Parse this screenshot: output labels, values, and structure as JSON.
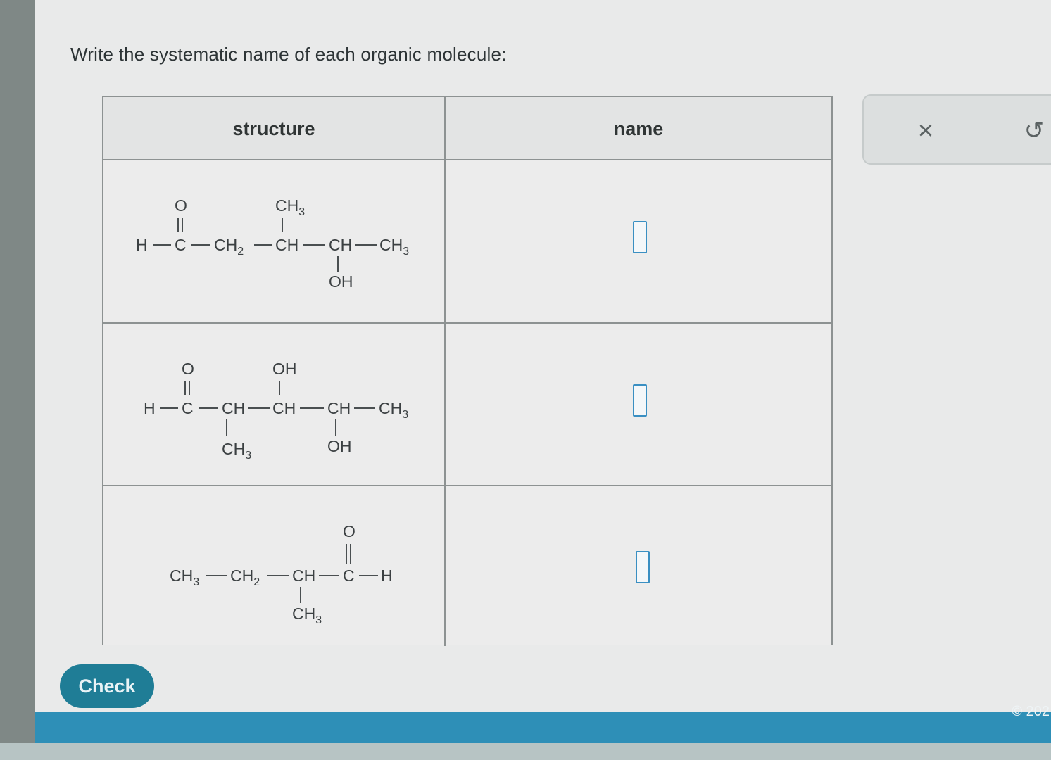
{
  "prompt": "Write the systematic name of each organic molecule:",
  "table": {
    "headers": {
      "structure": "structure",
      "name": "name"
    }
  },
  "rows": [
    {
      "name_value": "",
      "atoms": {
        "H": "H",
        "C": "C",
        "O": "O",
        "CH2": "CH",
        "sub2": "2",
        "CH_a": "CH",
        "CH3_top": "CH",
        "sub3_top": "3",
        "CH_b": "CH",
        "CH3_end": "CH",
        "sub3_end": "3",
        "OH": "OH"
      }
    },
    {
      "name_value": "",
      "atoms": {
        "H": "H",
        "C": "C",
        "O": "O",
        "CH_a": "CH",
        "CH3_low": "CH",
        "sub3_low": "3",
        "CH_b": "CH",
        "OH_top": "OH",
        "CH_c": "CH",
        "OH_low": "OH",
        "CH3_end": "CH",
        "sub3_end": "3"
      }
    },
    {
      "name_value": "",
      "atoms": {
        "CH3": "CH",
        "sub3": "3",
        "CH2": "CH",
        "sub2": "2",
        "CH": "CH",
        "CH3_low": "CH",
        "sub3_low": "3",
        "C": "C",
        "O": "O",
        "H": "H"
      }
    }
  ],
  "tools": {
    "clear": "×",
    "undo": "↺"
  },
  "check_label": "Check",
  "copyright": "© 202"
}
